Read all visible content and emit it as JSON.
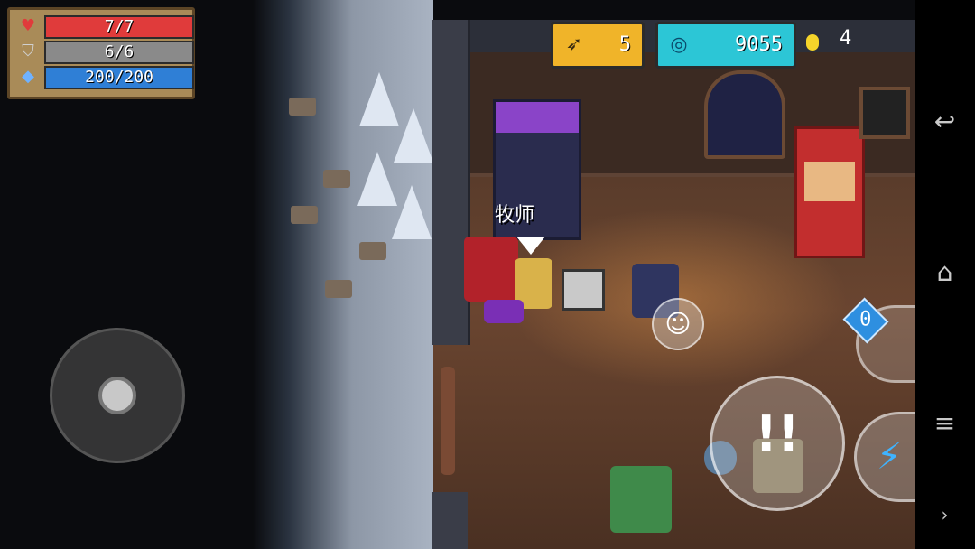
{
  "hud": {
    "health": {
      "icon": "heart-icon",
      "text": "7/7",
      "fraction": 1.0,
      "color": "#e03b3b"
    },
    "armor": {
      "icon": "shield-icon",
      "text": "6/6",
      "fraction": 1.0,
      "color": "#8a8a8a"
    },
    "energy": {
      "icon": "energy-crystal-icon",
      "text": "200/200",
      "fraction": 1.0,
      "color": "#2f7fd6"
    }
  },
  "resources": {
    "fish": {
      "icon": "fish-icon",
      "value": "5",
      "color": "#f0b429"
    },
    "gems": {
      "icon": "gem-icon",
      "value": "9055",
      "color": "#2cc6d6"
    },
    "coins": {
      "icon": "coin-icon",
      "value": "4"
    }
  },
  "world": {
    "machine_label": "牧师"
  },
  "controls": {
    "joystick": "joystick",
    "attack_icon": "attack-icon",
    "emote_icon": "emote-icon",
    "skill_icon": "lightning-icon",
    "weapon_energy_cost": "0"
  },
  "navbar": {
    "back_icon": "back-icon",
    "home_icon": "home-icon",
    "menu_icon": "menu-icon",
    "more_icon": "chevron-right-icon"
  }
}
